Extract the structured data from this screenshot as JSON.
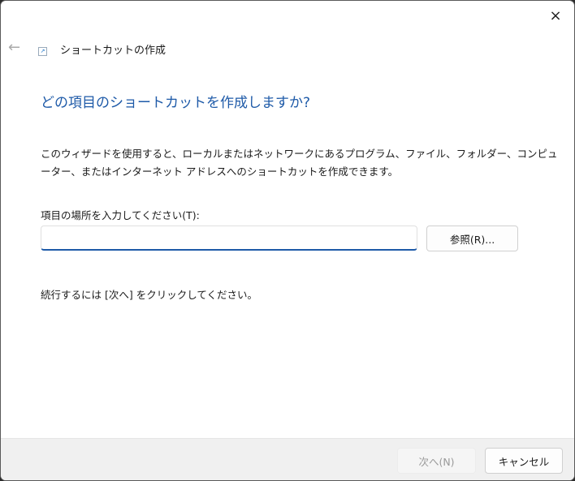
{
  "window": {
    "title": "ショートカットの作成",
    "close_icon": "×",
    "back_icon": "←"
  },
  "main": {
    "heading": "どの項目のショートカットを作成しますか?",
    "description": "このウィザードを使用すると、ローカルまたはネットワークにあるプログラム、ファイル、フォルダー、コンピューター、またはインターネット アドレスへのショートカットを作成できます。",
    "location_label": "項目の場所を入力してください(T):",
    "location_value": "",
    "browse_label": "参照(R)...",
    "hint": "続行するには [次へ] をクリックしてください。"
  },
  "footer": {
    "next_label": "次へ(N)",
    "cancel_label": "キャンセル"
  }
}
